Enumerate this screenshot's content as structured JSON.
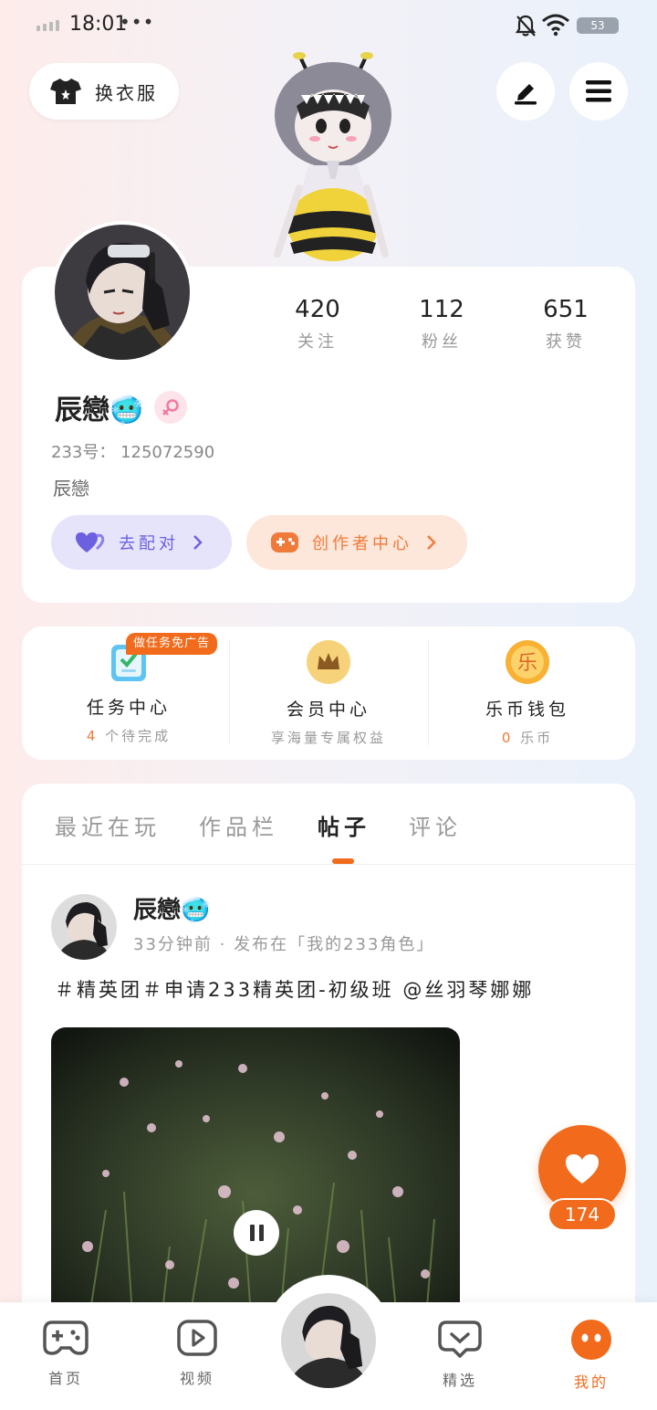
{
  "status_bar": {
    "time": "18:01",
    "dots": "•••",
    "battery": "53"
  },
  "header": {
    "outfit_label": "换衣服"
  },
  "profile": {
    "stats": [
      {
        "num": "420",
        "label": "关注"
      },
      {
        "num": "112",
        "label": "粉丝"
      },
      {
        "num": "651",
        "label": "获赞"
      }
    ],
    "username": "辰戀🥶",
    "uid_text": "233号： 125072590",
    "signature": "辰戀",
    "pair_label": "去配对",
    "creator_label": "创作者中心"
  },
  "quick": {
    "task_badge": "做任务免广告",
    "items": [
      {
        "title": "任务中心",
        "count": "4",
        "sub": " 个待完成"
      },
      {
        "title": "会员中心",
        "sub": "享海量专属权益"
      },
      {
        "title": "乐币钱包",
        "count": "0",
        "sub": " 乐币",
        "coin": "乐"
      }
    ]
  },
  "tabs": [
    "最近在玩",
    "作品栏",
    "帖子",
    "评论"
  ],
  "active_tab": "帖子",
  "post": {
    "author": "辰戀🥶",
    "meta": "33分钟前 · 发布在「我的233角色」",
    "text": "＃精英团＃申请233精英团-初级班 @丝羽琴娜娜"
  },
  "like_count": "174",
  "nav": [
    {
      "label": "首页"
    },
    {
      "label": "视频"
    },
    {
      "label": "精选"
    },
    {
      "label": "我的"
    }
  ],
  "colors": {
    "accent": "#f26a1b",
    "purple": "#6c5fe0",
    "background_left": "#fdecea",
    "background_right": "#e9f1fb"
  }
}
